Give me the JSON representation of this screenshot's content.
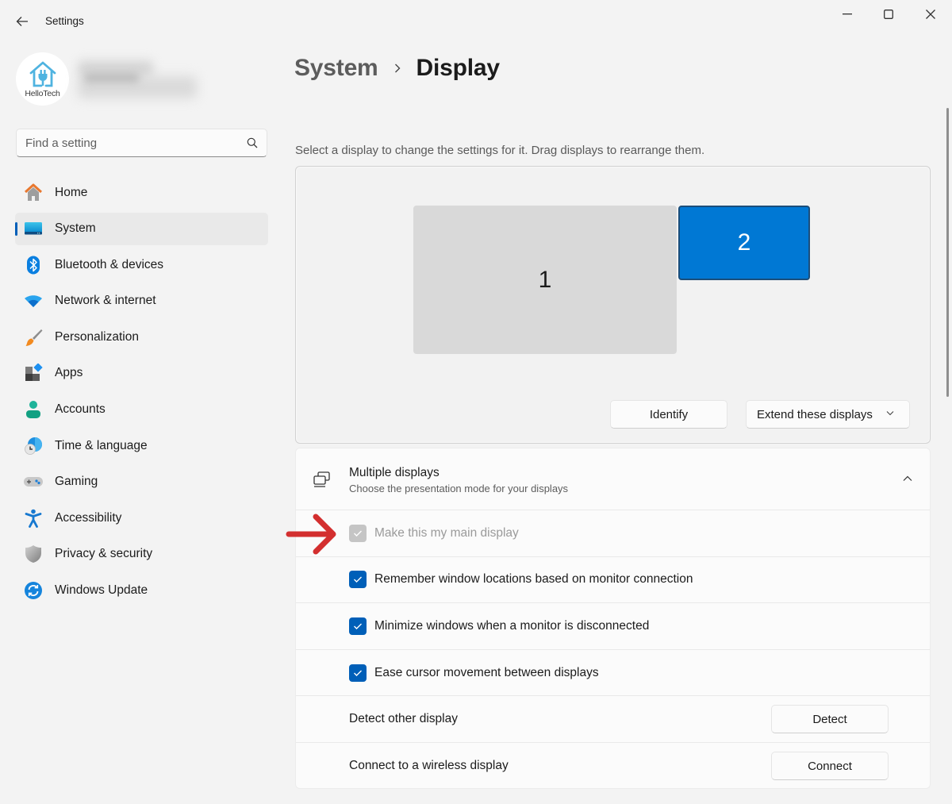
{
  "window": {
    "title": "Settings",
    "controls": {
      "minimize_icon": "minimize-icon",
      "maximize_icon": "maximize-icon",
      "close_icon": "close-icon"
    }
  },
  "profile": {
    "avatar_label": "HelloTech",
    "name": ""
  },
  "search": {
    "placeholder": "Find a setting",
    "value": ""
  },
  "sidebar": {
    "items": [
      {
        "label": "Home",
        "icon": "home-icon",
        "active": false
      },
      {
        "label": "System",
        "icon": "system-icon",
        "active": true
      },
      {
        "label": "Bluetooth & devices",
        "icon": "bluetooth-icon",
        "active": false
      },
      {
        "label": "Network & internet",
        "icon": "wifi-icon",
        "active": false
      },
      {
        "label": "Personalization",
        "icon": "paintbrush-icon",
        "active": false
      },
      {
        "label": "Apps",
        "icon": "apps-icon",
        "active": false
      },
      {
        "label": "Accounts",
        "icon": "accounts-icon",
        "active": false
      },
      {
        "label": "Time & language",
        "icon": "time-language-icon",
        "active": false
      },
      {
        "label": "Gaming",
        "icon": "gamepad-icon",
        "active": false
      },
      {
        "label": "Accessibility",
        "icon": "accessibility-icon",
        "active": false
      },
      {
        "label": "Privacy & security",
        "icon": "shield-icon",
        "active": false
      },
      {
        "label": "Windows Update",
        "icon": "update-icon",
        "active": false
      }
    ]
  },
  "main": {
    "breadcrumb": {
      "parent": "System",
      "separator": "›",
      "current": "Display"
    },
    "hint": "Select a display to change the settings for it. Drag displays to rearrange them.",
    "arrangement": {
      "monitors": [
        {
          "label": "1",
          "selected": false
        },
        {
          "label": "2",
          "selected": true
        }
      ],
      "identify_label": "Identify",
      "mode_select": {
        "value": "Extend these displays"
      }
    },
    "multiple_displays": {
      "title": "Multiple displays",
      "subtitle": "Choose the presentation mode for your displays",
      "expanded": true,
      "options": [
        {
          "label": "Make this my main display",
          "checked": true,
          "disabled": true
        },
        {
          "label": "Remember window locations based on monitor connection",
          "checked": true,
          "disabled": false
        },
        {
          "label": "Minimize windows when a monitor is disconnected",
          "checked": true,
          "disabled": false
        },
        {
          "label": "Ease cursor movement between displays",
          "checked": true,
          "disabled": false
        }
      ],
      "detect": {
        "label": "Detect other display",
        "button": "Detect"
      },
      "connect": {
        "label": "Connect to a wireless display",
        "button": "Connect"
      }
    }
  },
  "colors": {
    "accent": "#005fb8",
    "selected_monitor": "#0078d4",
    "annotation_arrow": "#d32f2f"
  }
}
